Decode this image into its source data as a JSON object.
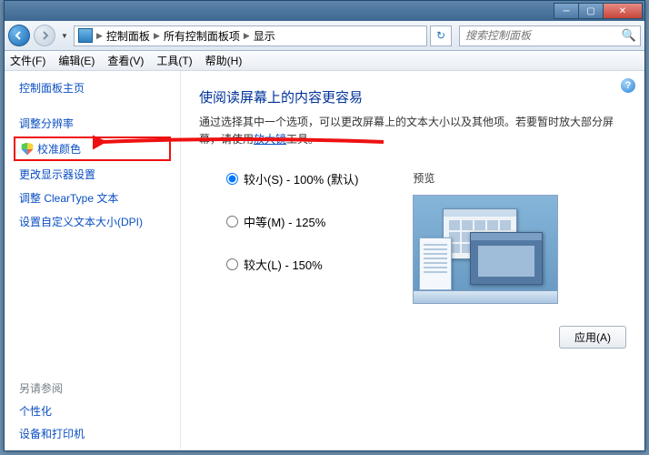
{
  "titlebar": {
    "min": "─",
    "max": "▢",
    "close": "✕"
  },
  "nav": {
    "breadcrumb": {
      "root": "控制面板",
      "mid": "所有控制面板项",
      "leaf": "显示"
    },
    "search_placeholder": "搜索控制面板"
  },
  "menu": {
    "file": "文件(F)",
    "edit": "编辑(E)",
    "view": "查看(V)",
    "tools": "工具(T)",
    "help": "帮助(H)"
  },
  "sidebar": {
    "home": "控制面板主页",
    "items": [
      "调整分辨率",
      "校准颜色",
      "更改显示器设置",
      "调整 ClearType 文本",
      "设置自定义文本大小(DPI)"
    ],
    "see_also_hdr": "另请参阅",
    "see_also": [
      "个性化",
      "设备和打印机"
    ]
  },
  "main": {
    "heading": "使阅读屏幕上的内容更容易",
    "desc_pre": "通过选择其中一个选项，可以更改屏幕上的文本大小以及其他项。若要暂时放大部分屏幕，请使用",
    "desc_link": "放大镜",
    "desc_post": "工具。",
    "options": {
      "small": "较小(S) - 100% (默认)",
      "medium": "中等(M) - 125%",
      "large": "较大(L) - 150%"
    },
    "preview_label": "预览",
    "apply": "应用(A)"
  }
}
